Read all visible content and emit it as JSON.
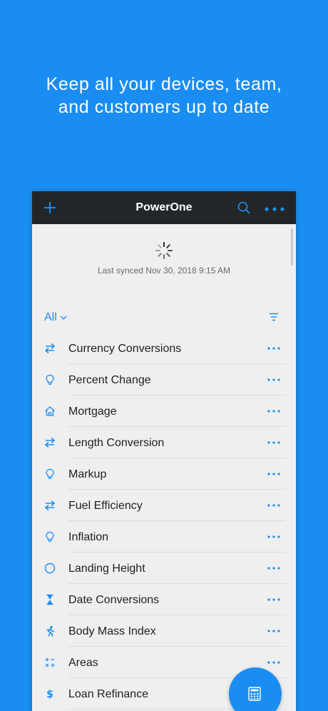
{
  "promo": {
    "headline_line1": "Keep all your devices, team,",
    "headline_line2": "and customers up to date"
  },
  "app": {
    "title": "PowerOne",
    "accent_color": "#1a8df2",
    "navbar_color": "#222629"
  },
  "sync": {
    "status": "Last synced Nov 30, 2018 9:15 AM"
  },
  "filter": {
    "selected": "All"
  },
  "list": {
    "items": [
      {
        "label": "Currency Conversions",
        "icon": "swap-arrows-icon"
      },
      {
        "label": "Percent Change",
        "icon": "lightbulb-icon"
      },
      {
        "label": "Mortgage",
        "icon": "house-icon"
      },
      {
        "label": "Length Conversion",
        "icon": "swap-arrows-icon"
      },
      {
        "label": "Markup",
        "icon": "lightbulb-icon"
      },
      {
        "label": "Fuel Efficiency",
        "icon": "swap-arrows-icon"
      },
      {
        "label": "Inflation",
        "icon": "lightbulb-icon"
      },
      {
        "label": "Landing Height",
        "icon": "circle-icon"
      },
      {
        "label": "Date Conversions",
        "icon": "hourglass-icon"
      },
      {
        "label": "Body Mass Index",
        "icon": "runner-icon"
      },
      {
        "label": "Areas",
        "icon": "math-operators-icon"
      },
      {
        "label": "Loan Refinance",
        "icon": "dollar-icon"
      }
    ]
  }
}
